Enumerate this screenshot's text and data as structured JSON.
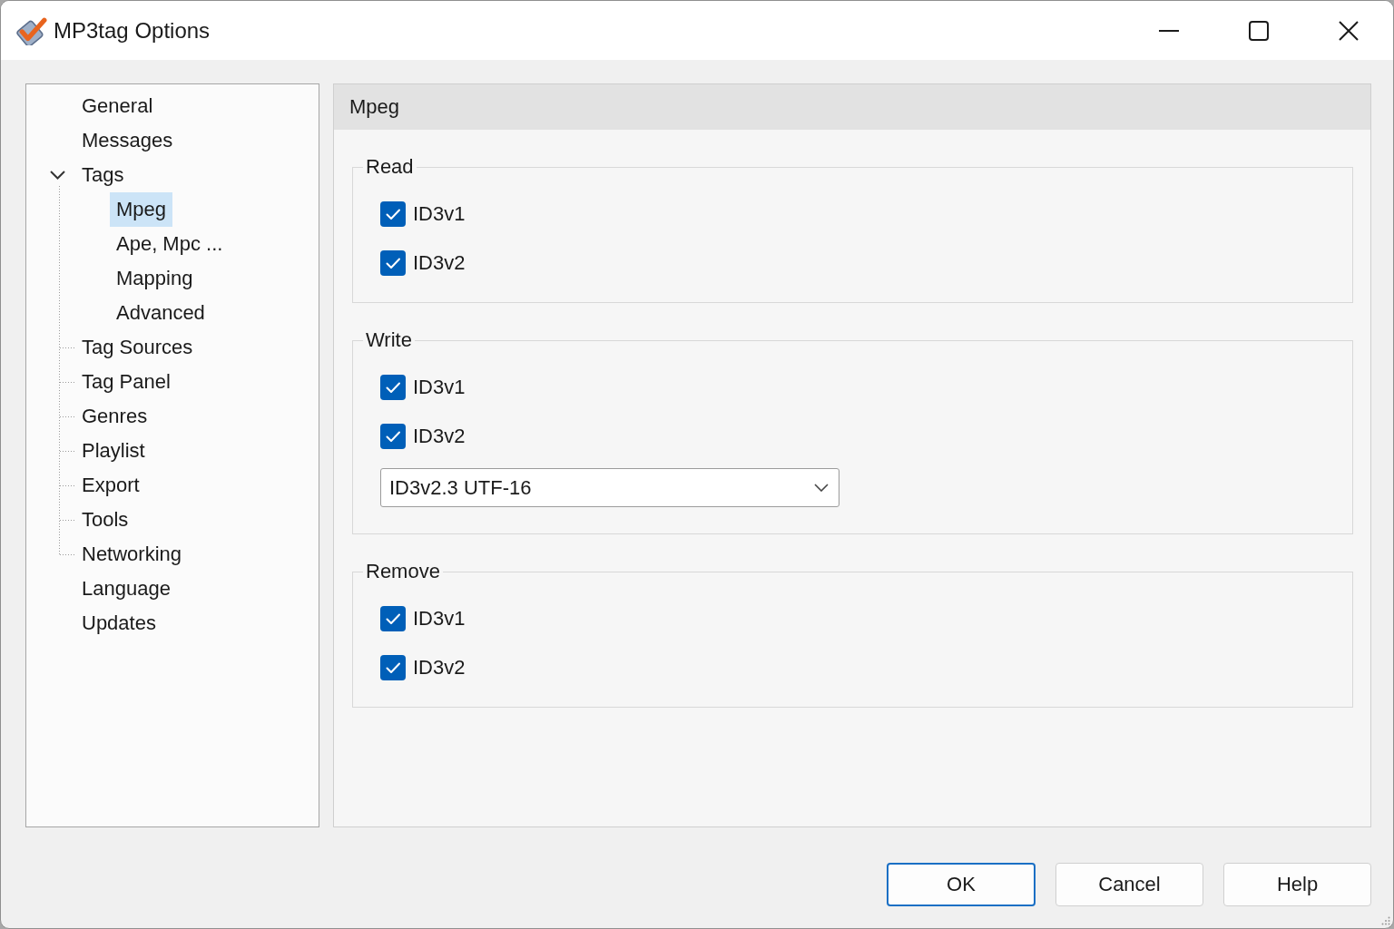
{
  "window": {
    "title": "MP3tag Options"
  },
  "tree": {
    "items": [
      {
        "label": "General",
        "selected": false,
        "connector": false
      },
      {
        "label": "Messages",
        "selected": false,
        "connector": false
      },
      {
        "label": "Tags",
        "selected": false,
        "connector": false,
        "expanded": true,
        "children": [
          {
            "label": "Mpeg",
            "selected": true
          },
          {
            "label": "Ape, Mpc ...",
            "selected": false
          },
          {
            "label": "Mapping",
            "selected": false
          },
          {
            "label": "Advanced",
            "selected": false
          }
        ]
      },
      {
        "label": "Tag Sources",
        "selected": false,
        "connector": true
      },
      {
        "label": "Tag Panel",
        "selected": false,
        "connector": true
      },
      {
        "label": "Genres",
        "selected": false,
        "connector": true
      },
      {
        "label": "Playlist",
        "selected": false,
        "connector": true
      },
      {
        "label": "Export",
        "selected": false,
        "connector": true
      },
      {
        "label": "Tools",
        "selected": false,
        "connector": true
      },
      {
        "label": "Networking",
        "selected": false,
        "connector": true
      },
      {
        "label": "Language",
        "selected": false,
        "connector": false
      },
      {
        "label": "Updates",
        "selected": false,
        "connector": false
      }
    ]
  },
  "page": {
    "title": "Mpeg",
    "groups": [
      {
        "title": "Read",
        "options": [
          {
            "kind": "checkbox",
            "label": "ID3v1",
            "checked": true
          },
          {
            "kind": "checkbox",
            "label": "ID3v2",
            "checked": true
          }
        ]
      },
      {
        "title": "Write",
        "options": [
          {
            "kind": "checkbox",
            "label": "ID3v1",
            "checked": true
          },
          {
            "kind": "checkbox",
            "label": "ID3v2",
            "checked": true
          },
          {
            "kind": "dropdown",
            "value": "ID3v2.3 UTF-16"
          }
        ]
      },
      {
        "title": "Remove",
        "options": [
          {
            "kind": "checkbox",
            "label": "ID3v1",
            "checked": true
          },
          {
            "kind": "checkbox",
            "label": "ID3v2",
            "checked": true
          }
        ]
      }
    ]
  },
  "buttons": [
    {
      "label": "OK",
      "default": true
    },
    {
      "label": "Cancel",
      "default": false
    },
    {
      "label": "Help",
      "default": false
    }
  ]
}
